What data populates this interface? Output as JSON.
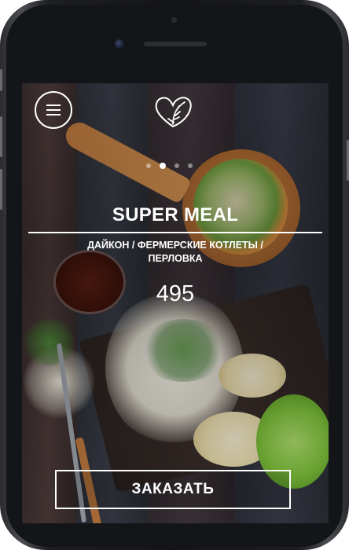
{
  "app": {
    "menu_icon": "hamburger-menu-icon",
    "logo_icon": "heart-leaf-logo-icon"
  },
  "carousel": {
    "total_dots": 4,
    "active_index": 1
  },
  "product": {
    "title": "SUPER MEAL",
    "description_line1": "ДАЙКОН / ФЕРМЕРСКИЕ КОТЛЕТЫ /",
    "description_line2": "ПЕРЛОВКА",
    "price": "495"
  },
  "actions": {
    "order_label": "ЗАКАЗАТЬ"
  },
  "colors": {
    "text": "#ffffff",
    "wood_dark": "#2d3038",
    "bowl": "#b9743a"
  }
}
